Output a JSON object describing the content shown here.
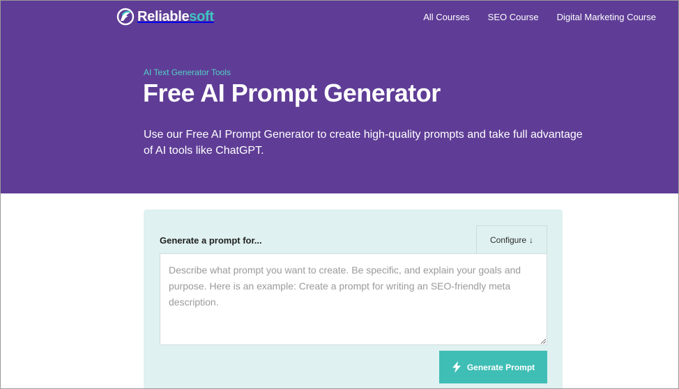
{
  "header": {
    "logo": {
      "text_main": "Reliable",
      "text_accent": "soft"
    },
    "nav": [
      {
        "label": "All Courses"
      },
      {
        "label": "SEO Course"
      },
      {
        "label": "Digital Marketing Course"
      }
    ]
  },
  "hero": {
    "eyebrow": "AI Text Generator Tools",
    "title": "Free AI Prompt Generator",
    "description": "Use our Free AI Prompt Generator to create high-quality prompts and take full advantage of AI tools like ChatGPT."
  },
  "generator": {
    "label": "Generate a prompt for...",
    "configure_label": "Configure",
    "configure_arrow": "↓",
    "placeholder": "Describe what prompt you want to create. Be specific, and explain your goals and purpose. Here is an example: Create a prompt for writing an SEO-friendly meta description.",
    "value": "",
    "generate_label": "Generate Prompt"
  },
  "colors": {
    "hero_bg": "#5f3d96",
    "accent_teal": "#3fbeb5",
    "card_bg": "#dff1f0"
  },
  "icons": {
    "logo": "reliablesoft-logo-icon",
    "configure": "arrow-down-icon",
    "generate": "lightning-bolt-icon"
  }
}
